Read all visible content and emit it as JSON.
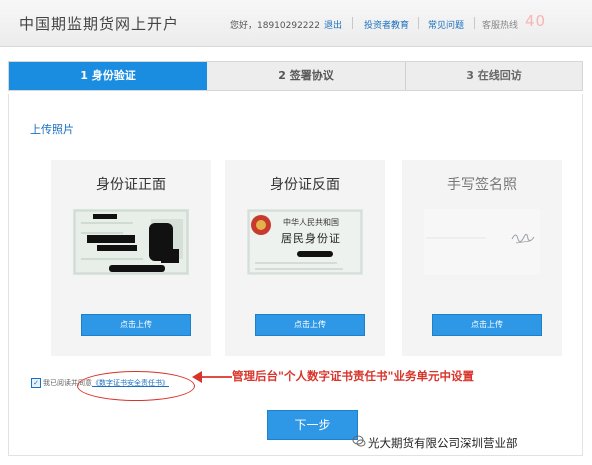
{
  "header": {
    "site_title": "中国期监期货网上开户",
    "greeting": "您好，18910292222",
    "logout": "退出",
    "links": [
      "投资者教育",
      "常见问题"
    ],
    "hotline_label": "客服热线",
    "hotline_number": "40"
  },
  "steps": [
    {
      "label": "1 身份验证",
      "active": true
    },
    {
      "label": "2 签署协议",
      "active": false
    },
    {
      "label": "3 在线回访",
      "active": false
    }
  ],
  "section_title": "上传照片",
  "cards": [
    {
      "title": "身份证正面",
      "button": "点击上传"
    },
    {
      "title": "身份证反面",
      "button": "点击上传"
    },
    {
      "title": "手写签名照",
      "button": "点击上传"
    }
  ],
  "id_back_text": {
    "line1": "中华人民共和国",
    "line2": "居民身份证"
  },
  "agreement": {
    "checked": true,
    "prefix": "我已阅读并同意",
    "link": "《数字证书安全责任书》"
  },
  "annotation": "管理后台\"个人数字证书责任书\"业务单元中设置",
  "next_button": "下一步",
  "watermark": "光大期货有限公司深圳营业部",
  "colors": {
    "accent": "#1a8de0",
    "annotation": "#d9342b"
  }
}
